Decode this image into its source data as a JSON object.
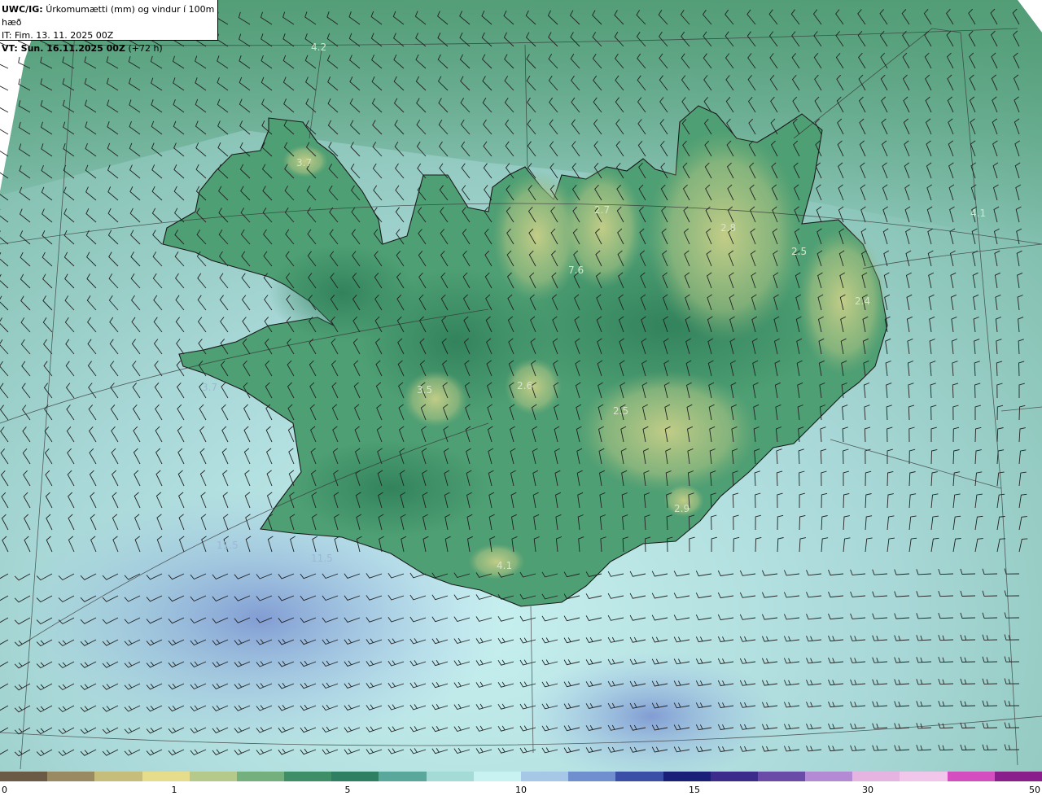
{
  "header": {
    "model": "UWC/IG:",
    "title": "Úrkomumætti (mm) og vindur í 100m hæð",
    "initial_time": "IT: Fim. 13. 11. 2025 00Z",
    "valid_time_bold": "VT: Sun. 16.11.2025 00Z",
    "valid_time_offset": "(+72 h)"
  },
  "map": {
    "colors": {
      "deep_sea_blue": "#7f9fd6",
      "pale_cyan": "#c6eef0",
      "teal": "#78b8a6",
      "green": "#3e8f68",
      "dark_green": "#2f7a58",
      "highland_yellow": "#c9cf86",
      "coast_line": "#1a1a1a"
    },
    "value_labels": [
      "4.2",
      "3.7",
      "2.7",
      "2.8",
      "2.5",
      "4.1",
      "7.6",
      "2.6",
      "3.5",
      "2.5",
      "2.9",
      "4.1",
      "3.7",
      "11.5",
      "11.5",
      "2.4"
    ]
  },
  "colorbar": {
    "ticks": [
      "0",
      "1",
      "5",
      "10",
      "15",
      "30",
      "50"
    ],
    "colors": [
      "#6b5a45",
      "#9a8a62",
      "#c6bd7a",
      "#e5dc8c",
      "#b5c98a",
      "#73b07e",
      "#3e8f68",
      "#2f7f63",
      "#5aa89b",
      "#a4dbd6",
      "#c8f2f2",
      "#a6c8e6",
      "#6f8fcf",
      "#3c4fa6",
      "#1a1f78",
      "#3b2b8a",
      "#6a4ba8",
      "#b48ad4",
      "#e6b4e0",
      "#f2c6ea",
      "#d44ec0",
      "#8a1e8a"
    ]
  }
}
